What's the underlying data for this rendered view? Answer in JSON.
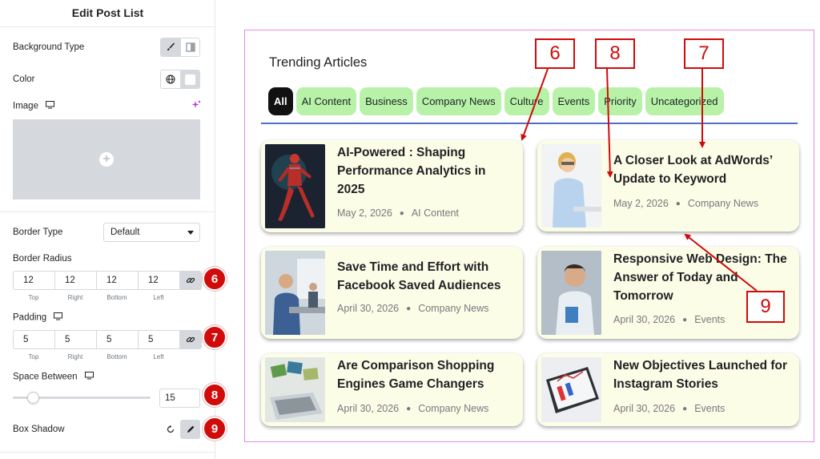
{
  "panel": {
    "title": "Edit Post List",
    "background_type_label": "Background Type",
    "color_label": "Color",
    "image_label": "Image",
    "border_type_label": "Border Type",
    "border_type_value": "Default",
    "border_radius_label": "Border Radius",
    "border_radius_values": [
      "12",
      "12",
      "12",
      "12"
    ],
    "padding_label": "Padding",
    "padding_values": [
      "5",
      "5",
      "5",
      "5"
    ],
    "dim_labels": [
      "Top",
      "Right",
      "Bottom",
      "Left"
    ],
    "space_between_label": "Space Between",
    "space_between_value": "15",
    "box_shadow_label": "Box Shadow",
    "badges": [
      "6",
      "7",
      "8",
      "9"
    ]
  },
  "preview": {
    "widget_title": "Trending Articles",
    "filters": [
      "All",
      "AI Content",
      "Business",
      "Company News",
      "Culture",
      "Events",
      "Priority",
      "Uncategorized"
    ],
    "active_filter": "All",
    "posts": [
      {
        "title": "AI-Powered : Shaping Performance Analytics in 2025",
        "date": "May 2, 2026",
        "category": "AI Content"
      },
      {
        "title": "A Closer Look at AdWords’ Update to Keyword",
        "date": "May 2, 2026",
        "category": "Company News"
      },
      {
        "title": "Save Time and Effort with Facebook Saved Audiences",
        "date": "April 30, 2026",
        "category": "Company News"
      },
      {
        "title": "Responsive Web Design: The Answer of Today and Tomorrow",
        "date": "April 30, 2026",
        "category": "Events"
      },
      {
        "title": "Are Comparison Shopping Engines Game Changers",
        "date": "April 30, 2026",
        "category": "Company News"
      },
      {
        "title": "New Objectives Launched for Instagram Stories",
        "date": "April 30, 2026",
        "category": "Events"
      }
    ],
    "callouts": [
      "6",
      "8",
      "7",
      "9"
    ]
  },
  "colors": {
    "filter_pill": "#b7f2a8",
    "filter_active": "#111111",
    "card_bg": "#fcfde6",
    "annotation_red": "#d10a0a",
    "preview_border": "#e58ae7",
    "filter_underline": "#4f6fc6"
  },
  "icons": {
    "background_type": [
      "brush-icon",
      "gradient-icon"
    ],
    "color": [
      "globe-icon",
      "color-swatch"
    ],
    "image": "plus-icon",
    "link": "link-icon",
    "device": "desktop-icon",
    "ai": "sparkle-icon",
    "box_shadow": [
      "reset-icon",
      "pencil-icon"
    ]
  }
}
